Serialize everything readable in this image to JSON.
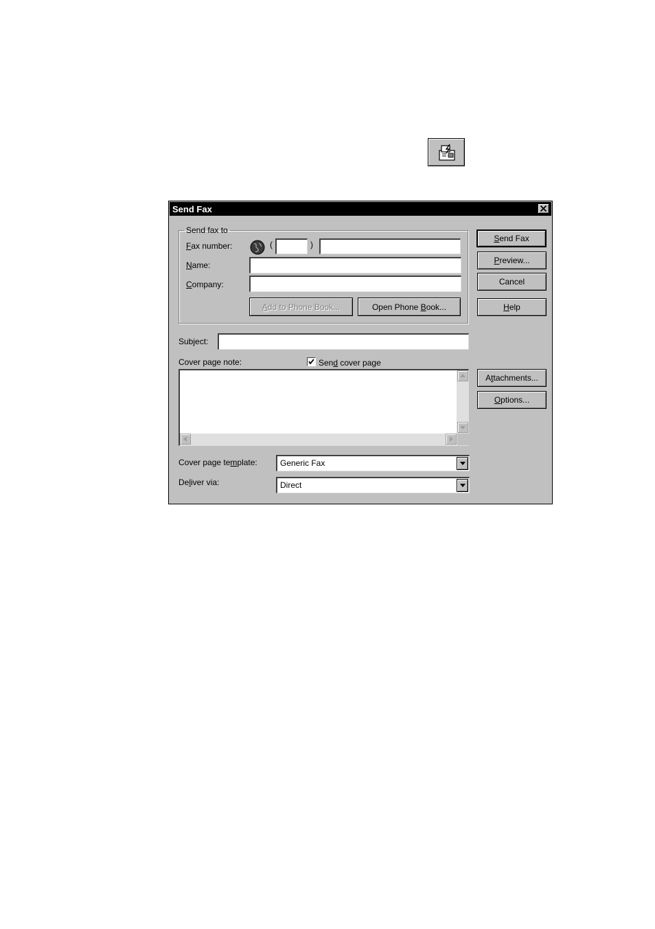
{
  "toolbar_icon": {
    "icon": "fax-machine-icon"
  },
  "dialog": {
    "title": "Send Fax",
    "send_to": {
      "legend": "Send fax to",
      "fax_number": {
        "label_accel": "F",
        "label_rest": "ax number:",
        "country_icon": "globe-icon",
        "open_paren": "(",
        "close_paren": ")",
        "area_code": "",
        "number": ""
      },
      "name": {
        "label_accel": "N",
        "label_rest": "ame:",
        "value": ""
      },
      "company": {
        "label_accel": "C",
        "label_rest": "ompany:",
        "value": ""
      },
      "add_to_book": {
        "pre": "",
        "accel": "A",
        "post": "dd to Phone Book..."
      },
      "open_book": {
        "pre": "Open Phone ",
        "accel": "B",
        "post": "ook..."
      }
    },
    "subject": {
      "label": "Subject:",
      "value": ""
    },
    "cover_note": {
      "label": "Cover page note:",
      "value": ""
    },
    "send_cover": {
      "checked": true,
      "pre": "Sen",
      "accel": "d",
      "post": " cover page"
    },
    "template": {
      "label_pre": "Cover page te",
      "label_accel": "m",
      "label_post": "plate:",
      "value": "Generic Fax"
    },
    "deliver": {
      "label_pre": "De",
      "label_accel": "l",
      "label_post": "iver via:",
      "value": "Direct"
    },
    "buttons": {
      "send_fax": {
        "pre": "",
        "accel": "S",
        "post": "end Fax"
      },
      "preview": {
        "pre": "",
        "accel": "P",
        "post": "review..."
      },
      "cancel": {
        "pre": "Cancel",
        "accel": "",
        "post": ""
      },
      "help": {
        "pre": "",
        "accel": "H",
        "post": "elp"
      },
      "attachments": {
        "pre": "A",
        "accel": "t",
        "post": "tachments..."
      },
      "options": {
        "pre": "",
        "accel": "O",
        "post": "ptions..."
      }
    }
  }
}
